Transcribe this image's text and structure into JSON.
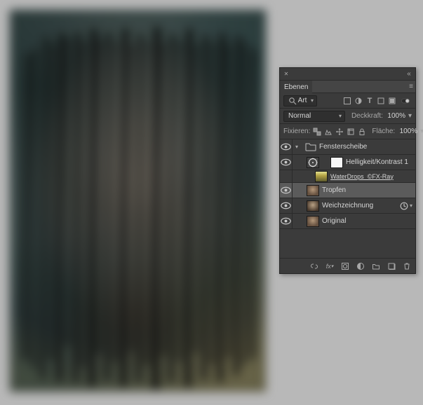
{
  "panel": {
    "title": "Ebenen",
    "kind_label": "Art",
    "blend_mode": "Normal",
    "opacity_label": "Deckkraft:",
    "opacity_value": "100%",
    "lock_label": "Fixieren:",
    "fill_label": "Fläche:",
    "fill_value": "100%"
  },
  "group": {
    "name": "Fensterscheibe"
  },
  "layers": [
    {
      "name": "Helligkeit/Kontrast 1",
      "visible": true,
      "type": "adjustment",
      "mask": true
    },
    {
      "name": "WaterDrops_©FX-Ray",
      "visible": false,
      "type": "image",
      "underline": true
    },
    {
      "name": "Tropfen",
      "visible": true,
      "type": "image",
      "selected": true
    },
    {
      "name": "Weichzeichnung",
      "visible": true,
      "type": "image",
      "fx": true
    },
    {
      "name": "Original",
      "visible": true,
      "type": "image"
    }
  ],
  "fx_badge": "fx"
}
